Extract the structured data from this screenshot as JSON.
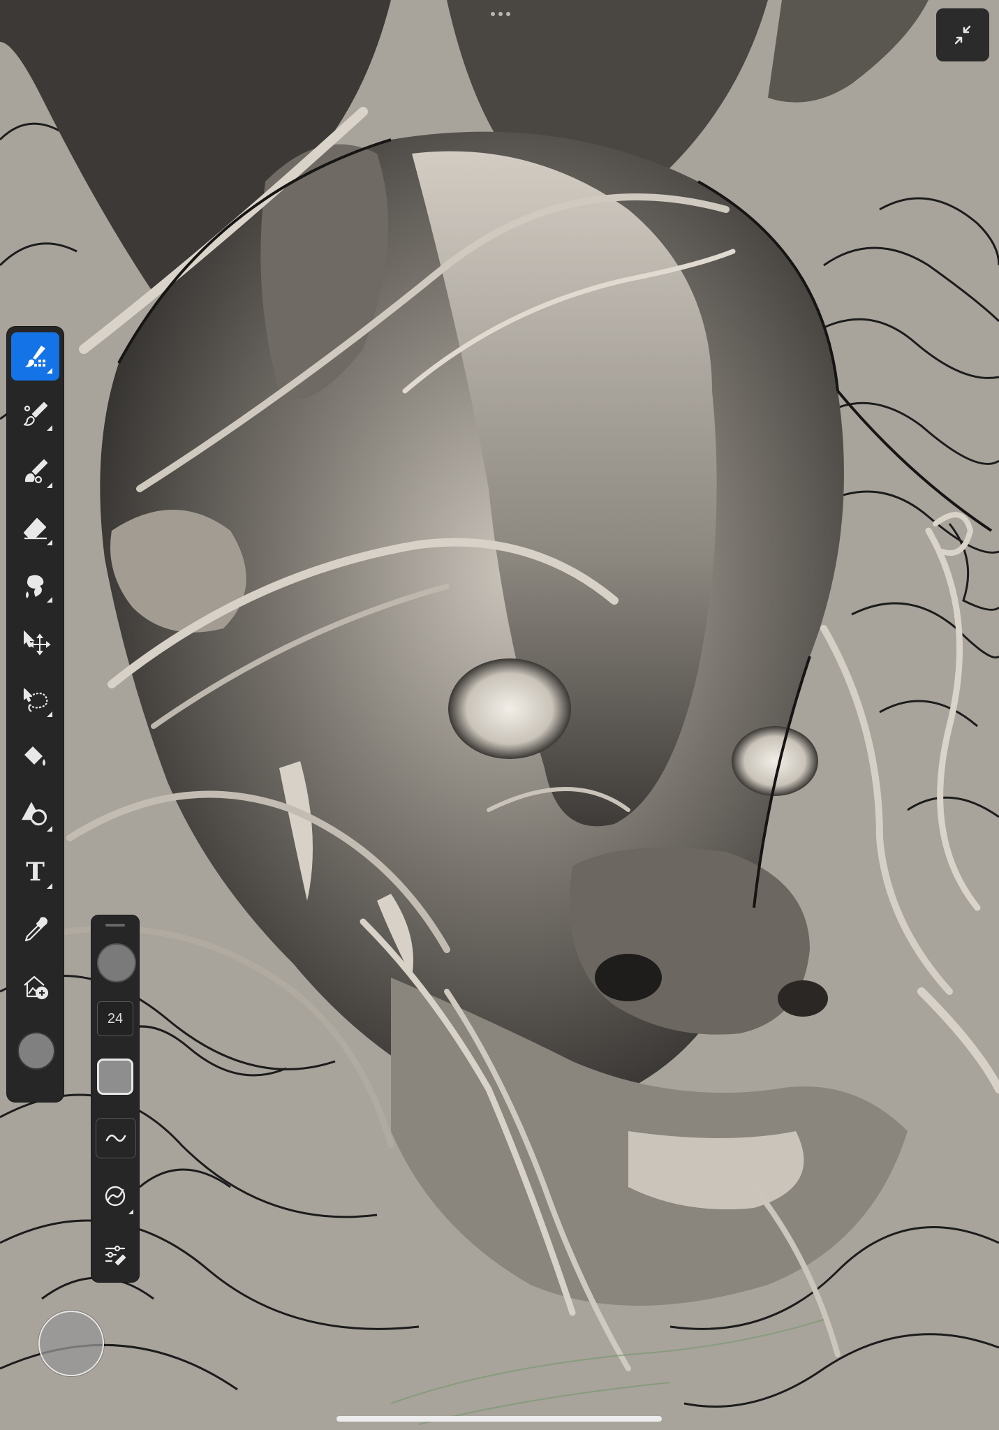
{
  "canvas": {
    "subject": "dragon-head-artwork"
  },
  "top_handle": {
    "dots": 3
  },
  "collapse_button": {
    "icon": "collapse-arrows-icon"
  },
  "toolbar": {
    "tools": [
      {
        "id": "pixel-brush",
        "icon": "pixel-brush-icon",
        "active": true
      },
      {
        "id": "live-brush",
        "icon": "live-brush-icon",
        "active": false
      },
      {
        "id": "vector-brush",
        "icon": "vector-brush-icon",
        "active": false
      },
      {
        "id": "eraser",
        "icon": "eraser-icon",
        "active": false
      },
      {
        "id": "smudge",
        "icon": "smudge-icon",
        "active": false
      },
      {
        "id": "transform",
        "icon": "transform-icon",
        "active": false
      },
      {
        "id": "lasso",
        "icon": "lasso-icon",
        "active": false
      },
      {
        "id": "fill",
        "icon": "fill-bucket-icon",
        "active": false
      },
      {
        "id": "shapes",
        "icon": "shapes-icon",
        "active": false
      },
      {
        "id": "text",
        "icon": "text-icon",
        "label": "T",
        "active": false
      },
      {
        "id": "eyedropper",
        "icon": "eyedropper-icon",
        "active": false
      },
      {
        "id": "place-image",
        "icon": "place-image-icon",
        "active": false
      }
    ],
    "current_color": "#808080"
  },
  "brush_panel": {
    "size_value": "24",
    "size_preview_color": "#7a7a7a",
    "opacity_color": "#8e8e8e",
    "buttons": [
      "smoothing-icon",
      "pressure-dynamics-icon",
      "brush-settings-icon"
    ]
  },
  "colors": {
    "accent": "#1473e6",
    "toolbar_bg": "#262626",
    "paper": "#a8a39b"
  }
}
